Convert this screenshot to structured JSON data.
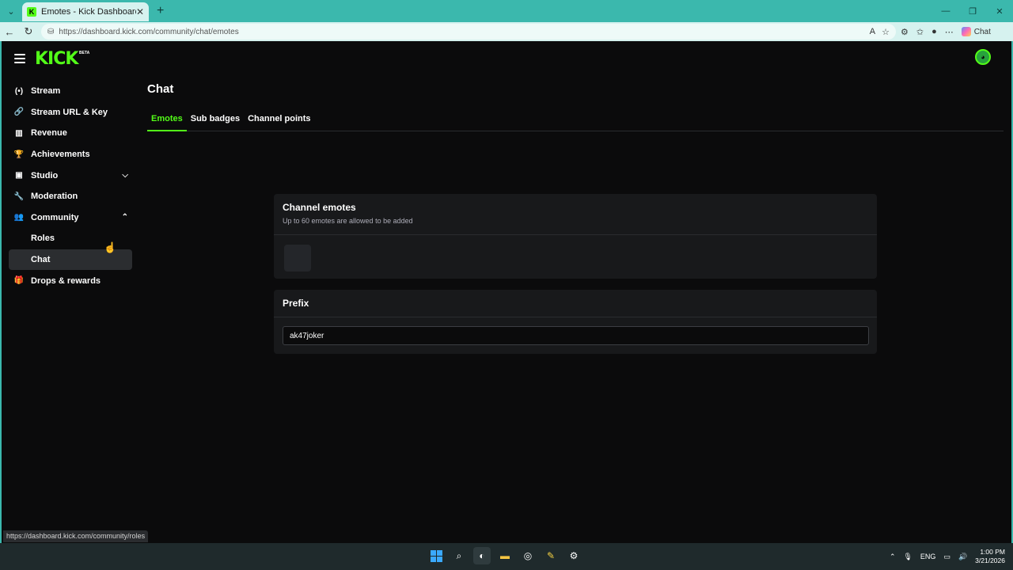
{
  "browser": {
    "tab_title": "Emotes - Kick Dashboard",
    "url": "https://dashboard.kick.com/community/chat/emotes",
    "chat_label": "Chat",
    "status_url": "https://dashboard.kick.com/community/roles"
  },
  "app": {
    "logo": "KICK",
    "logo_badge": "BETA"
  },
  "sidebar": {
    "items": [
      {
        "label": "Stream",
        "icon": "broadcast-icon"
      },
      {
        "label": "Stream URL & Key",
        "icon": "link-icon"
      },
      {
        "label": "Revenue",
        "icon": "chart-icon"
      },
      {
        "label": "Achievements",
        "icon": "trophy-icon"
      },
      {
        "label": "Studio",
        "icon": "studio-icon",
        "expanded": false
      },
      {
        "label": "Moderation",
        "icon": "wrench-icon"
      },
      {
        "label": "Community",
        "icon": "users-icon",
        "expanded": true
      },
      {
        "label": "Roles",
        "sub": true
      },
      {
        "label": "Chat",
        "sub": true,
        "active": true
      },
      {
        "label": "Drops & rewards",
        "icon": "gift-icon"
      }
    ]
  },
  "main": {
    "title": "Chat",
    "tabs": [
      {
        "label": "Emotes",
        "active": true
      },
      {
        "label": "Sub badges"
      },
      {
        "label": "Channel points"
      }
    ],
    "emotes_card": {
      "title": "Channel emotes",
      "subtitle": "Up to 60 emotes are allowed to be added"
    },
    "prefix_card": {
      "title": "Prefix",
      "value": "ak47joker"
    }
  },
  "taskbar": {
    "language": "ENG",
    "time": "1:00 PM",
    "date": "3/21/2026"
  },
  "colors": {
    "accent": "#53fc18",
    "browser_chrome": "#3bb8ad",
    "background": "#0b0b0c",
    "card": "#18191b"
  }
}
